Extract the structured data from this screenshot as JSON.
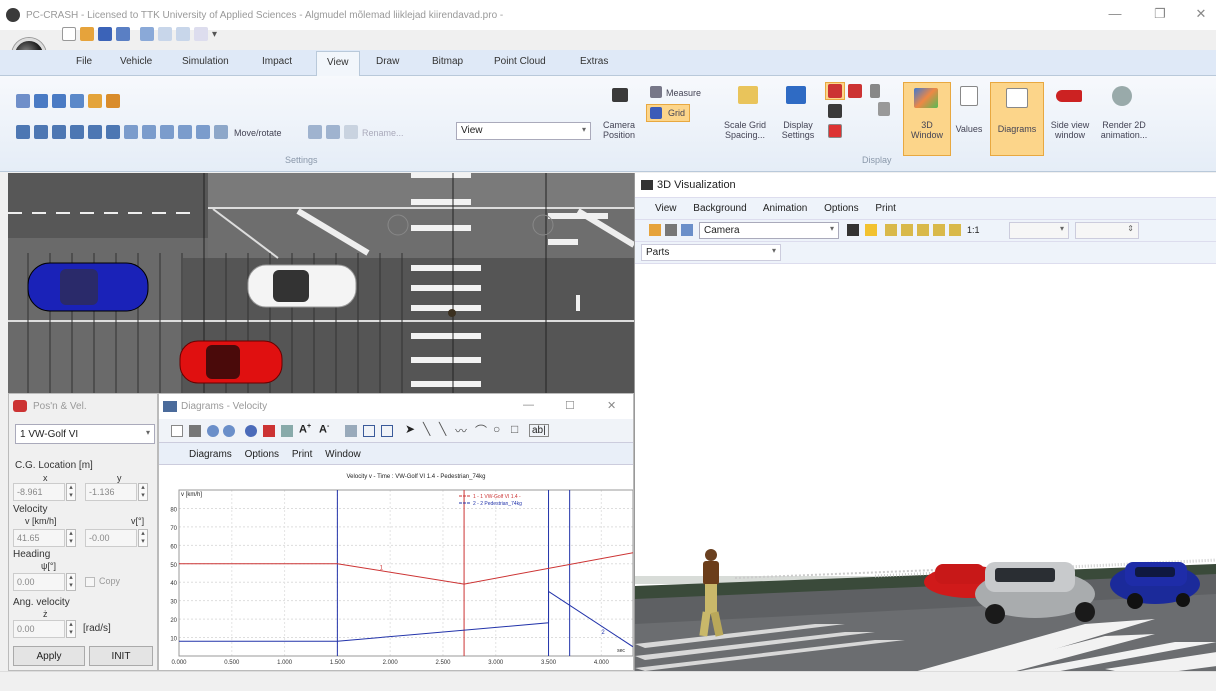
{
  "window": {
    "title": "PC-CRASH - Licensed to TTK University of Applied Sciences - Algmudel mõlemad liiklejad kiirendavad.pro -"
  },
  "tabs": [
    "File",
    "Vehicle",
    "Simulation",
    "Impact",
    "View",
    "Draw",
    "Bitmap",
    "Point Cloud",
    "Extras"
  ],
  "ribbon": {
    "settings_group": "Settings",
    "display_group": "Display",
    "move_rotate": "Move/rotate",
    "rename": "Rename...",
    "view_combo": "View",
    "measure": "Measure",
    "grid": "Grid",
    "camera_position": [
      "Camera",
      "Position"
    ],
    "scale_grid_spacing": [
      "Scale Grid",
      "Spacing..."
    ],
    "display_settings": [
      "Display",
      "Settings"
    ],
    "window_3d": [
      "3D",
      "Window"
    ],
    "values": "Values",
    "diagrams": "Diagrams",
    "side_view_window": [
      "Side view",
      "window"
    ],
    "render_2d_animation": [
      "Render 2D",
      "animation..."
    ]
  },
  "vis3d": {
    "title": "3D Visualization",
    "menu": [
      "View",
      "Background",
      "Animation",
      "Options",
      "Print"
    ],
    "camera_combo": "Camera",
    "ratio": "1:1",
    "parts_combo": "Parts"
  },
  "posvel": {
    "title": "Pos'n & Vel.",
    "vehicle": "1 VW-Golf VI",
    "cg_location": "C.G. Location [m]",
    "x_label": "x",
    "y_label": "y",
    "x_value": "-8.961",
    "y_value": "-1.136",
    "velocity": "Velocity",
    "v_label": "v [km/h]",
    "vdeg_label": "v[°]",
    "v_value": "41.65",
    "vdeg_value": "-0.00",
    "heading": "Heading",
    "psi_label": "ψ[°]",
    "psi_value": "0.00",
    "copy_label": "Copy",
    "ang_velocity": "Ang. velocity",
    "z_label": "ż",
    "z_value": "0.00",
    "rad_unit": "[rad/s]",
    "apply": "Apply",
    "init": "INIT"
  },
  "diagram": {
    "title": "Diagrams - Velocity",
    "menu": [
      "Diagrams",
      "Options",
      "Print",
      "Window"
    ],
    "text_tool": "ab|"
  },
  "chart_data": {
    "type": "line",
    "title": "Velocity v - Time : VW-Golf VI 1.4 - Pedestrian_74kg",
    "ylabel": "v [km/h]",
    "xlabel": "sec",
    "xlim": [
      0,
      4.3
    ],
    "ylim": [
      0,
      90
    ],
    "yticks": [
      "80",
      "70",
      "60",
      "50",
      "40",
      "30",
      "20",
      "10"
    ],
    "xticks": [
      "0.000",
      "0.500",
      "1.000",
      "1.500",
      "2.000",
      "2.500",
      "3.000",
      "3.500",
      "4.000"
    ],
    "series": [
      {
        "name": "1 - 1 VW-Golf VI 1.4 -",
        "color": "#cc3333",
        "x": [
          0,
          1.5,
          2.7,
          4.3
        ],
        "y": [
          50,
          50,
          39,
          56
        ],
        "label": "1"
      },
      {
        "name": "2 - 2 Pedestrian_74kg",
        "color": "#2233aa",
        "x": [
          0,
          1.5,
          3.5,
          3.5,
          4.3
        ],
        "y": [
          8,
          8,
          18,
          35,
          5
        ],
        "label": "2"
      }
    ],
    "vlines": [
      {
        "x": 1.5,
        "color": "#2233aa"
      },
      {
        "x": 2.7,
        "color": "#cc3333"
      },
      {
        "x": 3.5,
        "color": "#2233aa"
      },
      {
        "x": 3.7,
        "color": "#2233aa"
      }
    ],
    "legend": "top-right",
    "grid": true
  }
}
